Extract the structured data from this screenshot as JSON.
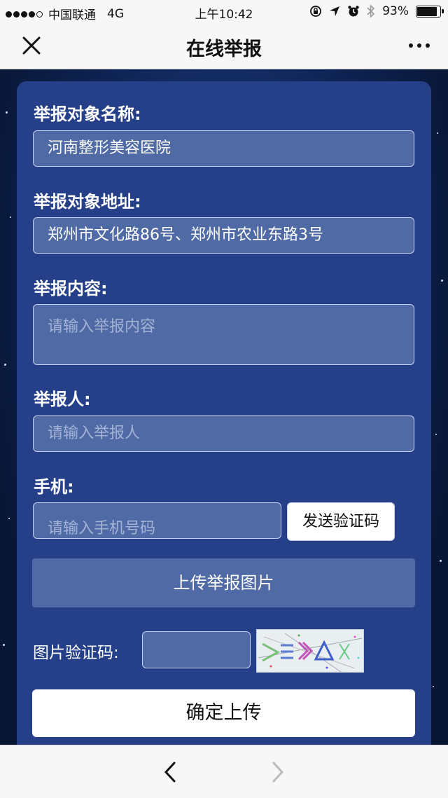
{
  "status": {
    "carrier": "中国联通",
    "network": "4G",
    "time": "上午10:42",
    "battery": "93%",
    "battery_level": 0.93
  },
  "nav": {
    "title": "在线举报",
    "close_icon": "close-icon",
    "more_icon": "more-icon"
  },
  "form": {
    "target_name_label": "举报对象名称:",
    "target_name_value": "河南整形美容医院",
    "target_address_label": "举报对象地址:",
    "target_address_value": "郑州市文化路86号、郑州市农业东路3号",
    "content_label": "举报内容:",
    "content_placeholder": "请输入举报内容",
    "reporter_label": "举报人:",
    "reporter_placeholder": "请输入举报人",
    "phone_label": "手机:",
    "phone_placeholder": "请输入手机号码",
    "send_code_label": "发送验证码",
    "upload_label": "上传举报图片",
    "captcha_label": "图片验证码:",
    "captcha_value": "",
    "submit_label": "确定上传"
  },
  "colors": {
    "card": "#253f88",
    "field": "#4f6aa4",
    "field_border": "#c5d1ee"
  }
}
